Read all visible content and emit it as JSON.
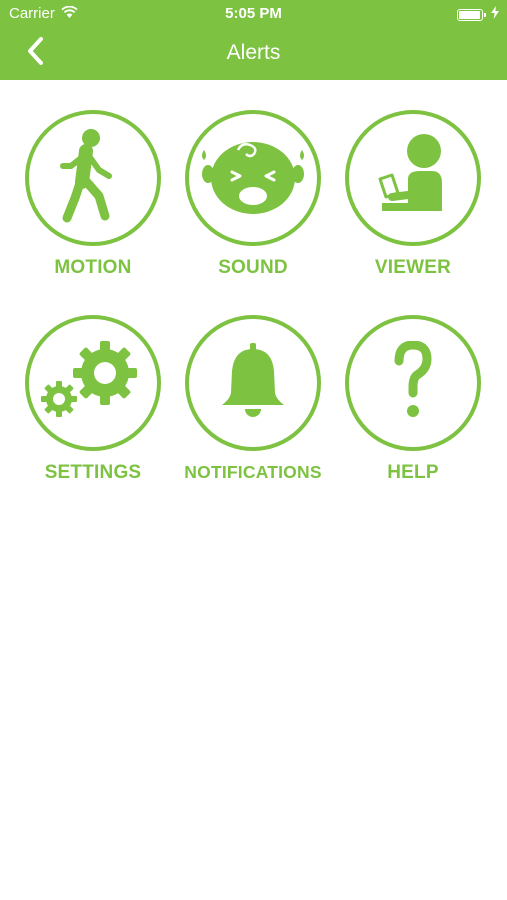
{
  "status_bar": {
    "carrier": "Carrier",
    "time": "5:05 PM",
    "battery_level": 1.0,
    "wifi_icon": "wifi-icon",
    "battery_icon": "battery-icon",
    "charging_icon": "lightning-icon"
  },
  "nav": {
    "title": "Alerts",
    "back_icon": "chevron-left-icon"
  },
  "tiles": [
    {
      "label": "MOTION",
      "icon": "walking-person-icon"
    },
    {
      "label": "SOUND",
      "icon": "crying-baby-icon"
    },
    {
      "label": "VIEWER",
      "icon": "viewer-person-icon"
    },
    {
      "label": "SETTINGS",
      "icon": "gears-icon"
    },
    {
      "label": "NOTIFICATIONS",
      "icon": "bell-icon"
    },
    {
      "label": "HELP",
      "icon": "question-mark-icon"
    }
  ],
  "colors": {
    "accent": "#7dc241",
    "background": "#ffffff",
    "header_text": "#ffffff"
  }
}
